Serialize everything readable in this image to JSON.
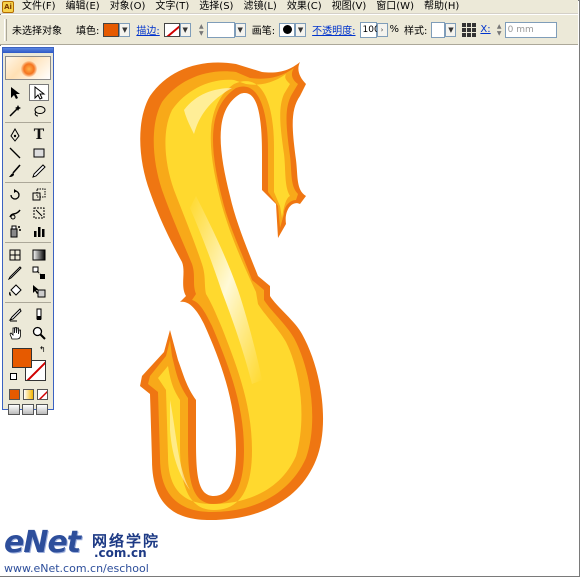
{
  "app": {
    "icon_label": "Ai"
  },
  "menu": {
    "items": [
      "文件(F)",
      "编辑(E)",
      "对象(O)",
      "文字(T)",
      "选择(S)",
      "滤镜(L)",
      "效果(C)",
      "视图(V)",
      "窗口(W)",
      "帮助(H)"
    ]
  },
  "control": {
    "selection_status": "未选择对象",
    "fill_label": "填色:",
    "stroke_label": "描边:",
    "brush_label": "画笔:",
    "opacity_label": "不透明度:",
    "opacity_value": "100",
    "percent": "%",
    "style_label": "样式:",
    "x_label": "X:",
    "x_value": "0 mm"
  },
  "colors": {
    "fill": "#e65a00",
    "stroke_none": "#d00000",
    "art_outer": "#f07a14",
    "art_mid": "#f9b21a",
    "art_inner": "#ffe24a",
    "art_highlight": "#fffbe0"
  },
  "tools": [
    "selection-tool",
    "direct-selection-tool",
    "magic-wand-tool",
    "lasso-tool",
    "pen-tool",
    "type-tool",
    "line-segment-tool",
    "rectangle-tool",
    "paintbrush-tool",
    "pencil-tool",
    "rotate-tool",
    "scale-tool",
    "warp-tool",
    "free-transform-tool",
    "symbol-sprayer-tool",
    "column-graph-tool",
    "mesh-tool",
    "gradient-tool",
    "eyedropper-tool",
    "blend-tool",
    "live-paint-bucket-tool",
    "live-paint-selection-tool",
    "slice-tool",
    "eraser-tool",
    "hand-tool",
    "zoom-tool"
  ],
  "watermark": {
    "logo": "eNet",
    "cn": "网络学院",
    "com": ".com.cn",
    "url": "www.eNet.com.cn/eschool"
  }
}
